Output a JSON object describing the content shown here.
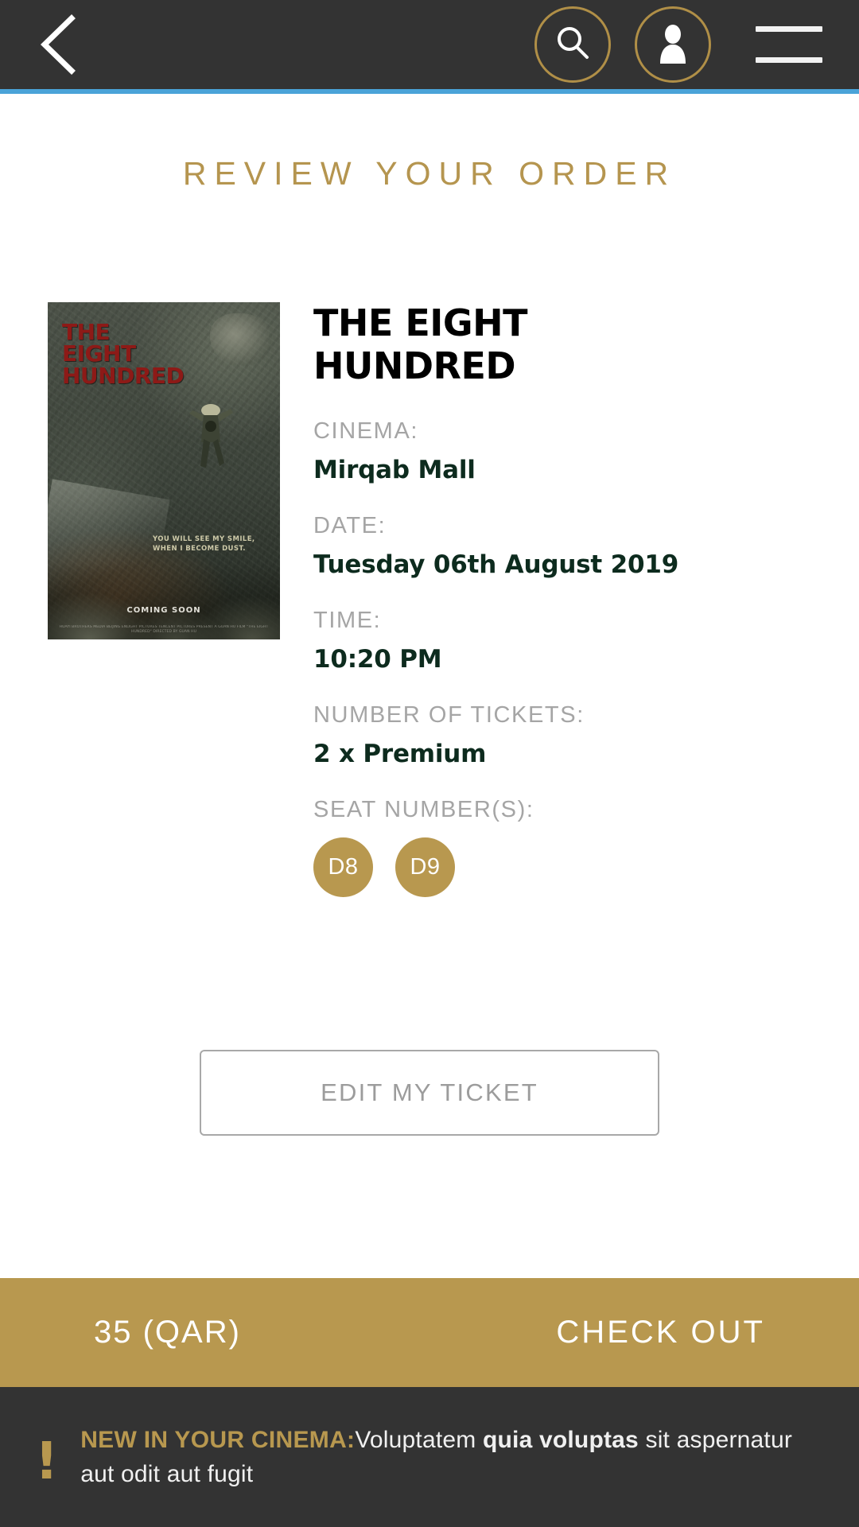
{
  "header": {
    "back_icon": "chevron-left-icon",
    "search_icon": "search-icon",
    "profile_icon": "user-icon",
    "menu_icon": "hamburger-menu-icon",
    "accent_color": "#4aa3d8",
    "background_color": "#333333",
    "gold_color": "#b08f47"
  },
  "page": {
    "title": "REVIEW YOUR ORDER",
    "title_color": "#b5954f"
  },
  "poster": {
    "title_line1": "THE",
    "title_line2": "EIGHT",
    "title_line3": "HUNDRED",
    "tagline_line1": "YOU WILL SEE MY SMILE,",
    "tagline_line2": "WHEN I BECOME DUST.",
    "coming_soon": "COMING SOON",
    "credits": "HUAYI BROTHERS MEDIA BEIJING ENLIGHT PICTURES TENCENT PICTURES PRESENT A GUAN HU FILM \"THE EIGHT HUNDRED\" DIRECTED BY GUAN HU"
  },
  "movie": {
    "title": "THE EIGHT HUNDRED"
  },
  "order": {
    "fields": [
      {
        "label": "CINEMA:",
        "value": "Mirqab Mall"
      },
      {
        "label": "DATE:",
        "value": "Tuesday 06th August 2019"
      },
      {
        "label": "TIME:",
        "value": "10:20 PM"
      },
      {
        "label": "NUMBER OF TICKETS:",
        "value": "2 x Premium"
      }
    ],
    "seats_label": "SEAT NUMBER(S):",
    "seats": [
      "D8",
      "D9"
    ],
    "seat_color": "#b8984f",
    "value_color": "#0d2b1e",
    "label_color": "#a5a5a5"
  },
  "actions": {
    "edit_ticket": "EDIT MY TICKET"
  },
  "checkout": {
    "price": "35 (QAR)",
    "button_label": "CHECK OUT",
    "background_color": "#b8984f"
  },
  "notice": {
    "icon": "exclamation-icon",
    "heading": "NEW IN YOUR CINEMA:",
    "body_start": "Voluptatem ",
    "body_strong": "quia voluptas",
    "body_end": " sit aspernatur aut odit aut fugit",
    "heading_color": "#b8984f",
    "background_color": "#333333"
  }
}
